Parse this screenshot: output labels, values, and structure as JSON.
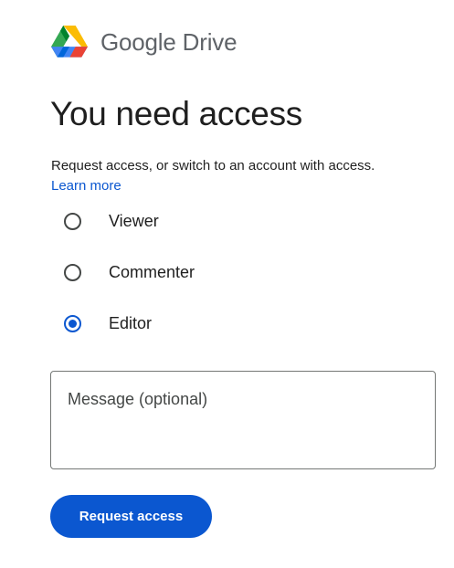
{
  "brand": {
    "logo_icon": "google-drive-logo-icon",
    "text": "Google Drive"
  },
  "title": "You need access",
  "description": {
    "text": "Request access, or switch to an account with access.",
    "link": "Learn more"
  },
  "roles": {
    "selected": "Editor",
    "options": [
      {
        "label": "Viewer",
        "checked": false
      },
      {
        "label": "Commenter",
        "checked": false
      },
      {
        "label": "Editor",
        "checked": true
      }
    ]
  },
  "message": {
    "placeholder": "Message (optional)",
    "value": ""
  },
  "actions": {
    "request_label": "Request access"
  },
  "colors": {
    "accent": "#0b57d0",
    "text": "#1f1f1f",
    "muted": "#5f6368",
    "drive_blue": "#4285f4",
    "drive_green": "#34a853",
    "drive_yellow": "#fbbc04",
    "drive_red": "#ea4335"
  }
}
